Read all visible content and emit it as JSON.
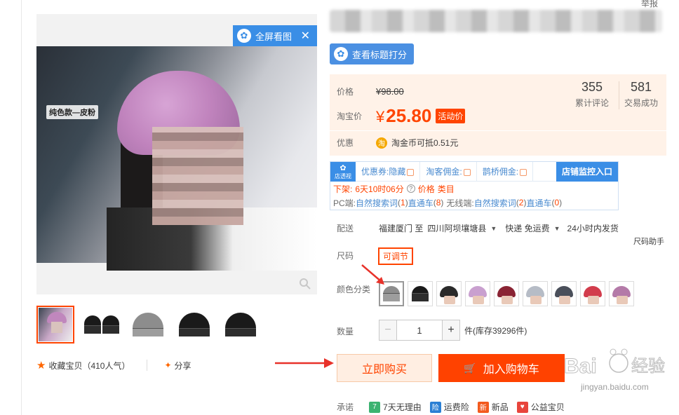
{
  "header": {
    "report_label": "举报"
  },
  "gallery": {
    "variant_tag": "纯色款—皮粉",
    "fullscreen_label": "全屏看图",
    "favorite_label": "收藏宝贝（410人气）",
    "share_label": "分享"
  },
  "plugin_title_button": "查看标题打分",
  "pricing": {
    "list_price_label": "价格",
    "list_price": "¥98.00",
    "taobao_price_label": "淘宝价",
    "currency": "¥",
    "taobao_price": "25.80",
    "activity_tag": "活动价",
    "reviews_count": "355",
    "reviews_label": "累计评论",
    "deals_count": "581",
    "deals_label": "交易成功",
    "promo_label": "优惠",
    "promo_text": "淘金币可抵0.51元",
    "coin_icon_text": "淘"
  },
  "plugin": {
    "logo_text": "店透视",
    "tabs": [
      "优惠券:隐藏",
      "淘客佣金:",
      "鹊桥佣金:"
    ],
    "monitor_label": "店铺监控入口",
    "line1_offshelf_label": "下架:",
    "line1_time": "6天10时06分",
    "line1_price": "价格",
    "line1_category": "类目",
    "line2": {
      "pc_label": "PC端:",
      "pc_natural": "自然搜索词",
      "pc_natural_count": "1",
      "pc_train": "直通车",
      "pc_train_count": "8",
      "wireless_label": "无线端:",
      "wl_natural": "自然搜索词",
      "wl_natural_count": "2",
      "wl_train": "直通车",
      "wl_train_count": "0"
    }
  },
  "delivery": {
    "label": "配送",
    "from": "福建厦门 至",
    "to": "四川阿坝壤塘县",
    "method": "快递 免运费",
    "time": "24小时内发货"
  },
  "size": {
    "label": "尺码",
    "helper": "尺码助手",
    "option": "可调节"
  },
  "color_label": "颜色分类",
  "quantity": {
    "label": "数量",
    "value": "1",
    "stock": "件(库存39296件)",
    "minus": "−",
    "plus": "+"
  },
  "actions": {
    "buy_now": "立即购买",
    "add_to_cart": "加入购物车"
  },
  "promise": {
    "label": "承诺",
    "items": [
      "7天无理由",
      "运费险",
      "新品",
      "公益宝贝"
    ]
  },
  "watermark_text": "jingyan.baidu.com",
  "colors": {
    "accent": "#ff4400",
    "plugin_blue": "#3a8ee6",
    "price_bg": "#fff2e8"
  }
}
